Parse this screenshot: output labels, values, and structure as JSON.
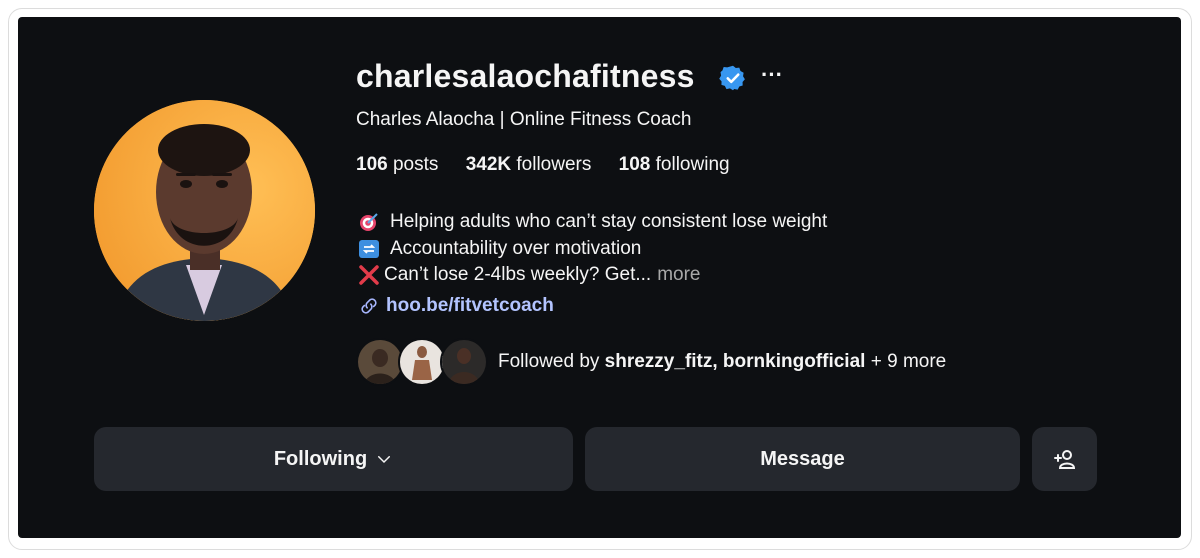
{
  "profile": {
    "username": "charlesalaochafitness",
    "full_name": "Charles Alaocha | Online Fitness Coach",
    "verified_badge_color": "#3897f0"
  },
  "stats": {
    "posts_count": "106",
    "posts_label": "posts",
    "followers_count": "342K",
    "followers_label": "followers",
    "following_count": "108",
    "following_label": "following"
  },
  "bio": {
    "line1": "Helping adults who can’t stay consistent lose weight",
    "line2": "Accountability over motivation",
    "line3": "Can’t lose 2-4lbs weekly? Get...",
    "more_label": "more",
    "line1_icon": "target-icon",
    "line2_icon": "repeat-icon",
    "line3_icon": "cross-mark-icon"
  },
  "link": {
    "text": "hoo.be/fitvetcoach",
    "icon": "link-icon"
  },
  "followed_by": {
    "prefix": "Followed by",
    "names": "shrezzy_fitz, bornkingofficial",
    "suffix": "+ 9 more"
  },
  "buttons": {
    "following": "Following",
    "message": "Message",
    "add_user_icon": "add-user-icon"
  },
  "more_options": "···"
}
